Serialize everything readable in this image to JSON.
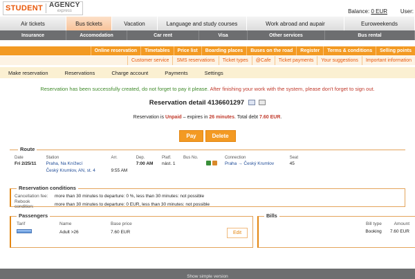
{
  "logo": {
    "part1": "STUDENT",
    "part2": "AGENCY",
    "sub": "express"
  },
  "header": {
    "balance_label": "Balance:",
    "balance_value": "0 EUR",
    "user_label": "User:"
  },
  "main_tabs": [
    {
      "label": "Air tickets"
    },
    {
      "label": "Bus tickets"
    },
    {
      "label": "Vacation"
    },
    {
      "label": "Language and study courses"
    },
    {
      "label": "Work abroad and aupair"
    },
    {
      "label": "Euroweekends"
    }
  ],
  "sub_bar": [
    {
      "label": "Insurance"
    },
    {
      "label": "Accomodation"
    },
    {
      "label": "Car rent"
    },
    {
      "label": "Visa"
    },
    {
      "label": "Other services"
    },
    {
      "label": "Bus rental"
    }
  ],
  "orange_nav": [
    {
      "label": "Online reservation"
    },
    {
      "label": "Timetables"
    },
    {
      "label": "Price list"
    },
    {
      "label": "Boarding places"
    },
    {
      "label": "Buses on the road"
    },
    {
      "label": "Register"
    },
    {
      "label": "Terms & conditions"
    },
    {
      "label": "Selling points"
    }
  ],
  "secondary_nav": [
    {
      "label": "Customer service"
    },
    {
      "label": "SMS reservations"
    },
    {
      "label": "Ticket types"
    },
    {
      "label": "@Cafe"
    },
    {
      "label": "Ticket payments"
    },
    {
      "label": "Your suggestions"
    },
    {
      "label": "Important information"
    }
  ],
  "action_bar": [
    {
      "label": "Make reservation"
    },
    {
      "label": "Reservations"
    },
    {
      "label": "Charge account"
    },
    {
      "label": "Payments"
    },
    {
      "label": "Settings"
    }
  ],
  "message": {
    "green": "Reservation has been successfully created, do not forget to pay it please.",
    "red": "After finishing your work with the system, please don't forget to sign out."
  },
  "reservation": {
    "title": "Reservation detail 4136601297",
    "status_prefix": "Reservation is",
    "status": "Unpaid",
    "expires_prefix": "– expires in",
    "expires": "26 minutes",
    "debt_label": ". Total debt",
    "debt": "7.60 EUR",
    "debt_suffix": "."
  },
  "buttons": {
    "pay": "Pay",
    "delete": "Delete"
  },
  "route": {
    "legend": "Route",
    "headers": [
      "Date",
      "Station",
      "Arr.",
      "Dep.",
      "Platf.",
      "Bus No.",
      "",
      "Connection",
      "Seat"
    ],
    "row1": {
      "date": "Fri 2/25/11",
      "station": "Praha, Na Knížecí",
      "arr": "",
      "dep": "7:00 AM",
      "platf": "nást. 1",
      "bus": "",
      "connection": "Praha → Český Krumlov",
      "seat": "45"
    },
    "row2": {
      "station": "Český Krumlov, AN, st. 4",
      "arr": "9:55 AM"
    }
  },
  "conditions": {
    "legend": "Reservation conditions",
    "rows": [
      {
        "label": "Cancellation fee:",
        "value": "more than 30 minutes to departure: 0 %, less than 30 minutes: not possible"
      },
      {
        "label": "Rebook condition:",
        "value": "more than 30 minutes to departure: 0 EUR, less than 30 minutes: not possible"
      }
    ]
  },
  "passengers": {
    "legend": "Passengers",
    "headers": [
      "Tarif",
      "Name",
      "Base price"
    ],
    "rows": [
      {
        "name": "Adult >26",
        "price": "7.60 EUR"
      }
    ],
    "edit": "Edit"
  },
  "bills": {
    "legend": "Bills",
    "headers": [
      "Bill type",
      "Amount"
    ],
    "rows": [
      {
        "type": "Booking",
        "amount": "7.60 EUR"
      }
    ]
  },
  "footer": {
    "link": "Show simple version"
  }
}
